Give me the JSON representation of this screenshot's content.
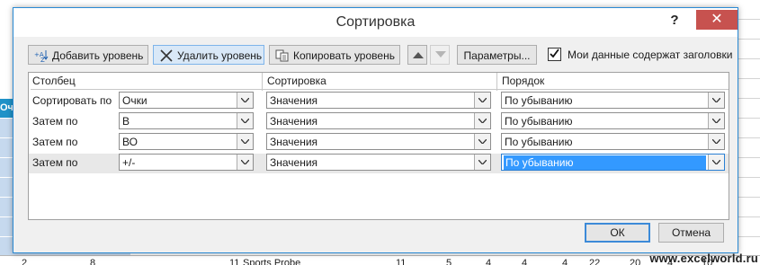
{
  "dialog": {
    "title": "Сортировка",
    "help": "?",
    "close": "✕"
  },
  "toolbar": {
    "add_level": "Добавить уровень",
    "delete_level": "Удалить уровень",
    "copy_level": "Копировать уровень",
    "options": "Параметры...",
    "headers_checkbox_label": "Мои данные содержат заголовки",
    "headers_checked": true
  },
  "table": {
    "headers": {
      "column": "Столбец",
      "sort_on": "Сортировка",
      "order": "Порядок"
    },
    "rows": [
      {
        "label": "Сортировать по",
        "column": "Очки",
        "sort_on": "Значения",
        "order": "По убыванию",
        "selected": false
      },
      {
        "label": "Затем по",
        "column": "В",
        "sort_on": "Значения",
        "order": "По убыванию",
        "selected": false
      },
      {
        "label": "Затем по",
        "column": "ВО",
        "sort_on": "Значения",
        "order": "По убыванию",
        "selected": false
      },
      {
        "label": "Затем по",
        "column": "+/-",
        "sort_on": "Значения",
        "order": "По убыванию",
        "selected": true
      }
    ]
  },
  "buttons": {
    "ok": "ОК",
    "cancel": "Отмена"
  },
  "sheet": {
    "header_cell": "Очк",
    "bottom_row": [
      "2",
      "8",
      "11",
      "Sports Probe",
      "11",
      "5",
      "4",
      "4",
      "4",
      "22",
      "20",
      "4",
      "10"
    ],
    "watermark": "www.excelworld.ru"
  },
  "colors": {
    "accent": "#2a8ad4",
    "close": "#c7524f",
    "selection": "#3399ff"
  }
}
